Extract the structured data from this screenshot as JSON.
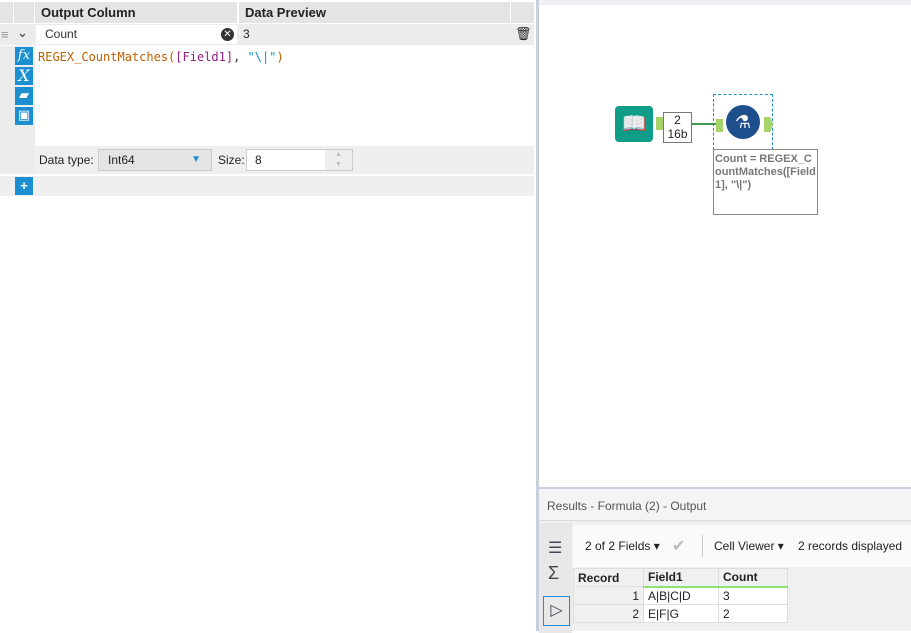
{
  "formula_panel": {
    "col_output": "Output Column",
    "col_preview": "Data Preview",
    "field_name": "Count",
    "preview_value": "3",
    "expression": {
      "func": "REGEX_CountMatches(",
      "field": "[Field1]",
      "sep": ", ",
      "str": "\"\\|\"",
      "close": ")"
    },
    "data_type_label": "Data type:",
    "data_type": "Int64",
    "size_label": "Size:",
    "size": "8"
  },
  "canvas": {
    "connection_count": "2",
    "connection_size": "16b",
    "annotation": "Count = REGEX_CountMatches([Field1], \"\\|\")"
  },
  "results": {
    "title": "Results - Formula (2) - Output",
    "fields": "2 of 2 Fields",
    "viewer": "Cell Viewer",
    "records": "2 records displayed",
    "columns": [
      "Record",
      "Field1",
      "Count"
    ],
    "rows": [
      [
        "1",
        "A|B|C|D",
        "3"
      ],
      [
        "2",
        "E|F|G",
        "2"
      ]
    ]
  }
}
